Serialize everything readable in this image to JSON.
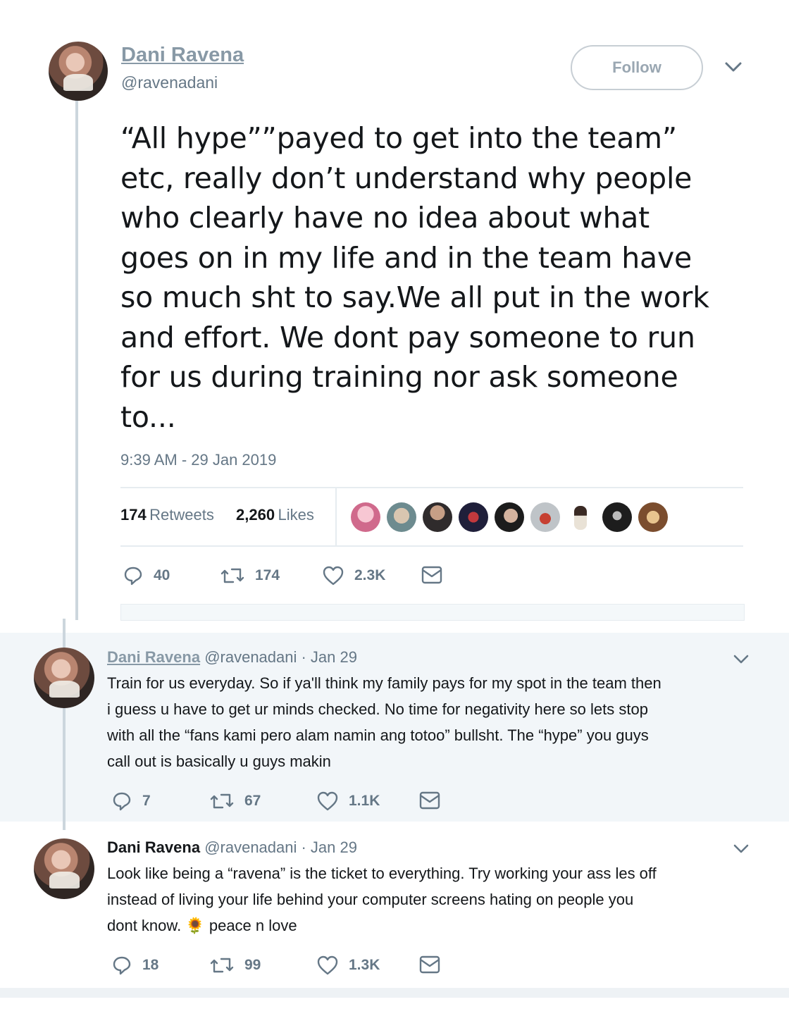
{
  "tweet": {
    "author_name": "Dani Ravena",
    "handle": "@ravenadani",
    "follow_label": "Follow",
    "text": "“All hype””payed to get into the team”\netc, really don’t understand why people\nwho clearly have no idea about what\ngoes on in my life and in the team have\nso much sht to say.We all put in the work\nand effort. We dont pay someone to run\nfor us during training nor ask someone\nto...",
    "timestamp": "9:39 AM - 29 Jan 2019",
    "retweets_count": "174",
    "retweets_label": "Retweets",
    "likes_count": "2,260",
    "likes_label": "Likes",
    "actions": {
      "replies": "40",
      "retweets": "174",
      "likes": "2.3K"
    }
  },
  "replies": [
    {
      "author_name": "Dani Ravena",
      "handle_date": "@ravenadani · Jan 29",
      "text": "Train for us everyday. So if ya'll think my family pays for my spot in the team then\ni guess u have to get ur minds checked. No time for negativity here so lets stop\nwith all the “fans kami pero alam namin ang totoo” bullsht. The “hype” you guys\ncall out is basically u guys makin",
      "actions": {
        "replies": "7",
        "retweets": "67",
        "likes": "1.1K"
      }
    },
    {
      "author_name": "Dani Ravena",
      "handle_date": "@ravenadani · Jan 29",
      "text_line1": "Look like being a “ravena” is the ticket to everything. Try working your ass les off",
      "text_line2": "instead of living your life behind your computer screens hating on people you",
      "text_line3a": "dont know.",
      "emoji": "🌻",
      "text_line3b": "peace n love",
      "actions": {
        "replies": "18",
        "retweets": "99",
        "likes": "1.3K"
      }
    }
  ],
  "colors": {
    "link_gray": "#8899a6",
    "muted": "#657786",
    "reply_bg": "#f2f6f9",
    "separator": "#e6ecf0"
  },
  "icons": [
    "reply-icon",
    "retweet-icon",
    "like-icon",
    "message-icon",
    "chevron-down-icon"
  ]
}
